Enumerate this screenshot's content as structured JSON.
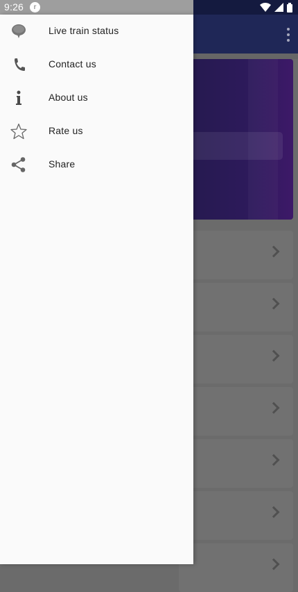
{
  "status_bar": {
    "time": "9:26",
    "app_icon": "r-app-icon",
    "icons": [
      "wifi-icon",
      "signal-icon",
      "battery-icon"
    ]
  },
  "drawer": {
    "items": [
      {
        "label": "Live train status",
        "icon": "chat-bubble-icon"
      },
      {
        "label": "Contact us",
        "icon": "phone-icon"
      },
      {
        "label": "About us",
        "icon": "info-icon"
      },
      {
        "label": "Rate us",
        "icon": "star-icon"
      },
      {
        "label": "Share",
        "icon": "share-icon"
      }
    ]
  },
  "background_app": {
    "toolbar_color": "#1f2757",
    "menu_icon": "overflow-menu-icon",
    "card_count": 7,
    "card_icon": "chevron-right-icon"
  },
  "colors": {
    "drawer_bg": "#fafafa",
    "scrim": "#6b6b6b",
    "icon": "#616161",
    "text": "#212121"
  }
}
